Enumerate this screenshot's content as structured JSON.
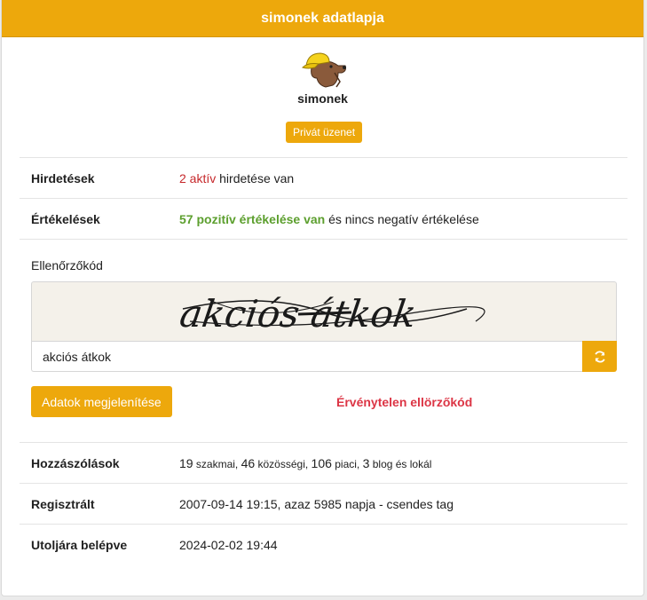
{
  "header": {
    "title": "simonek adatlapja"
  },
  "profile": {
    "avatar_icon": "dog-with-cap-icon",
    "username": "simonek",
    "pm_label": "Privát üzenet"
  },
  "rows_top": {
    "ads": {
      "label": "Hirdetések",
      "count_text": "2 aktív",
      "rest": " hirdetése van"
    },
    "ratings": {
      "label": "Értékelések",
      "positive_text": "57 pozitív értékelése van",
      "rest": " és nincs negatív értékelése"
    }
  },
  "captcha": {
    "label": "Ellenőrzőkód",
    "image_text": "akciós átkok",
    "input_value": "akciós átkok",
    "refresh_icon": "refresh-icon",
    "submit_label": "Adatok megjelenítése",
    "error_text": "Érvénytelen ellörzőkód"
  },
  "rows_bottom": {
    "comments": {
      "label": "Hozzászólások",
      "n1": "19",
      "t1": " szakmai, ",
      "n2": "46",
      "t2": " közösségi, ",
      "n3": "106",
      "t3": " piaci, ",
      "n4": "3",
      "t4": " blog és lokál"
    },
    "registered": {
      "label": "Regisztrált",
      "value": "2007-09-14 19:15, azaz 5985 napja - csendes tag"
    },
    "last_login": {
      "label": "Utoljára belépve",
      "value": "2024-02-02 19:44"
    }
  },
  "colors": {
    "accent": "#eda80c",
    "error": "#dc3545",
    "positive": "#5c9f2e",
    "count": "#c6282b"
  }
}
